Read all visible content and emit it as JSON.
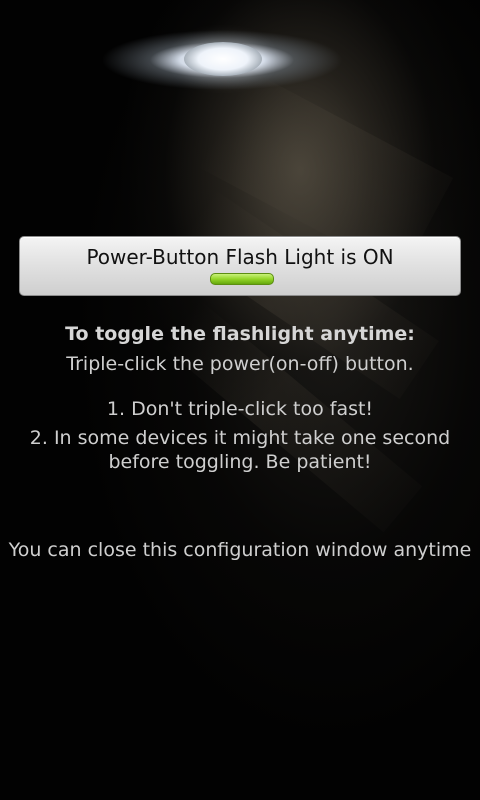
{
  "toggle": {
    "label": "Power-Button Flash Light is ON",
    "state": "on",
    "indicator_color": "#94d629"
  },
  "instructions": {
    "heading": "To toggle the flashlight anytime:",
    "text": "Triple-click the power(on-off) button.",
    "tips": [
      "1. Don't triple-click too fast!",
      "2. In some devices it might take one second before toggling.  Be patient!"
    ],
    "close_note": "You can close this configuration window anytime"
  }
}
